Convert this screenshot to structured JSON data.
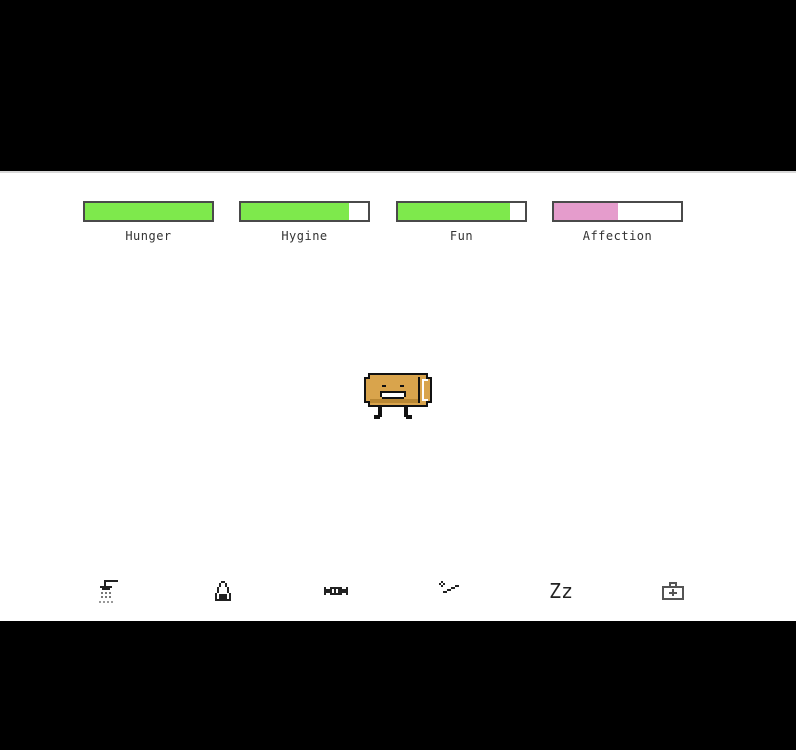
{
  "stats": [
    {
      "label": "Hunger",
      "level": 1.0,
      "color": "#7ee94c"
    },
    {
      "label": "Hygine",
      "level": 0.85,
      "color": "#7ee94c"
    },
    {
      "label": "Fun",
      "level": 0.88,
      "color": "#7ee94c"
    },
    {
      "label": "Affection",
      "level": 0.5,
      "color": "#e59ccc"
    }
  ],
  "pet": {
    "body_color": "#d9a44c",
    "outline_color": "#111111"
  },
  "toolbar": [
    {
      "name": "shower",
      "icon": "shower-icon"
    },
    {
      "name": "feed",
      "icon": "onigiri-icon"
    },
    {
      "name": "treat",
      "icon": "candy-icon"
    },
    {
      "name": "play",
      "icon": "wand-icon"
    },
    {
      "name": "sleep",
      "icon": "zz-icon",
      "text": "Zz"
    },
    {
      "name": "medicine",
      "icon": "medkit-icon"
    }
  ]
}
